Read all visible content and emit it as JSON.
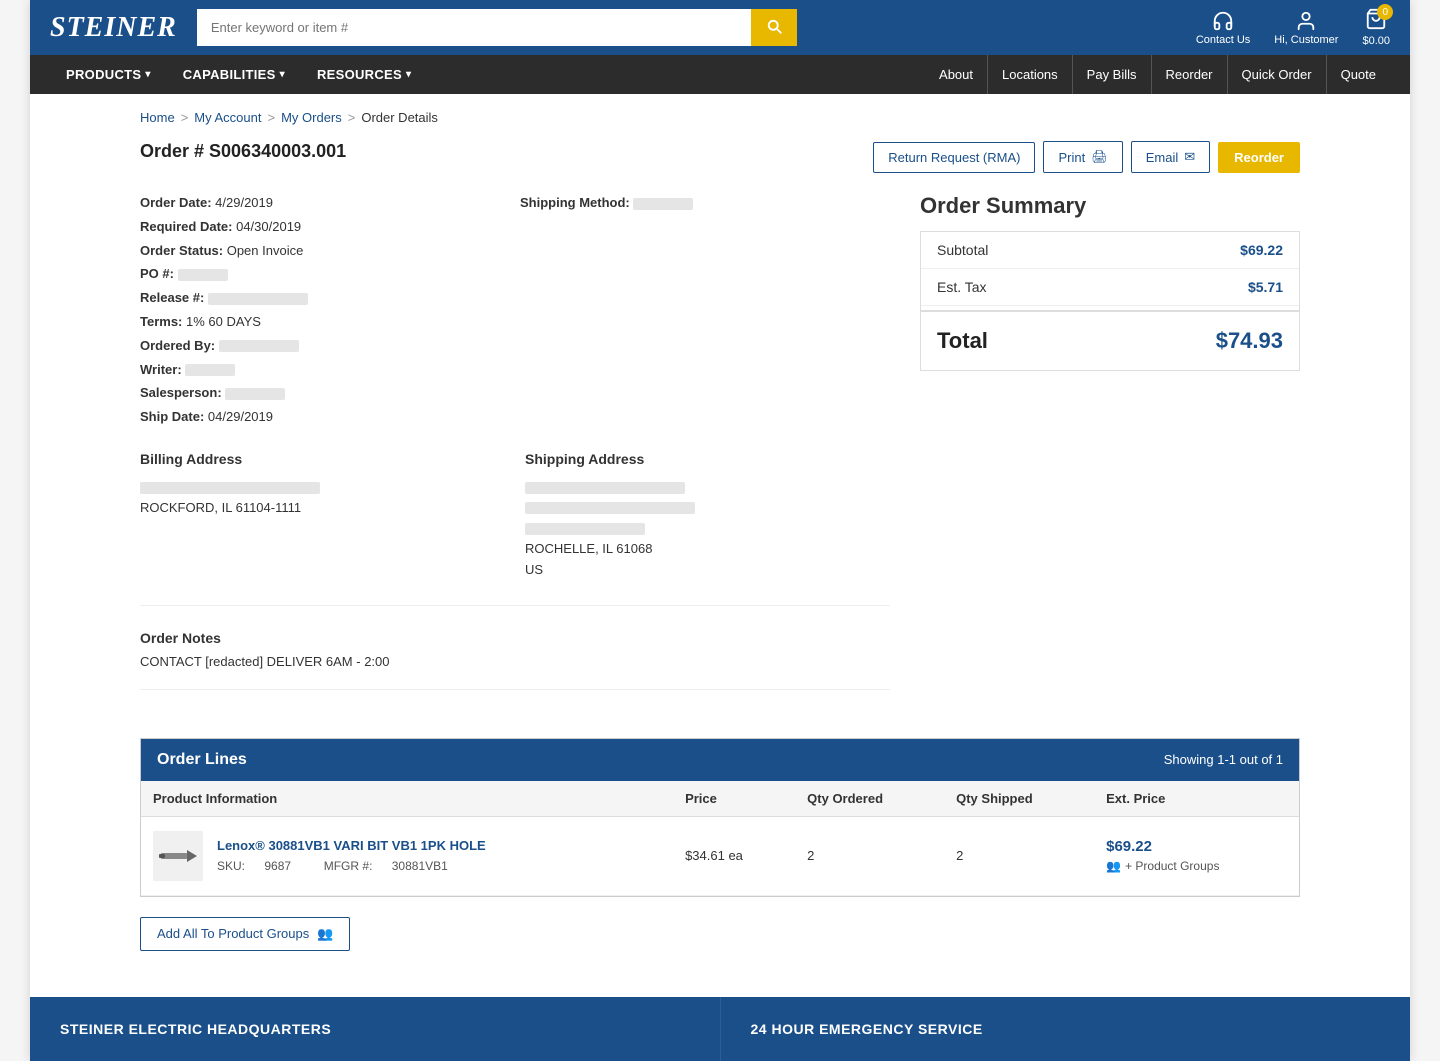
{
  "header": {
    "logo": "SteineR",
    "search_placeholder": "Enter keyword or item #",
    "contact_label": "Contact Us",
    "account_label": "Hi, Customer",
    "cart_label": "$0.00",
    "cart_count": "0"
  },
  "nav": {
    "left_items": [
      {
        "label": "PRODUCTS",
        "has_dropdown": true
      },
      {
        "label": "CAPABILITIES",
        "has_dropdown": true
      },
      {
        "label": "RESOURCES",
        "has_dropdown": true
      }
    ],
    "right_items": [
      {
        "label": "About"
      },
      {
        "label": "Locations"
      },
      {
        "label": "Pay Bills"
      },
      {
        "label": "Reorder"
      },
      {
        "label": "Quick Order"
      },
      {
        "label": "Quote"
      }
    ]
  },
  "breadcrumb": {
    "items": [
      {
        "label": "Home",
        "link": true
      },
      {
        "label": "My Account",
        "link": true
      },
      {
        "label": "My Orders",
        "link": true
      },
      {
        "label": "Order Details",
        "link": false
      }
    ]
  },
  "order": {
    "number": "Order # S006340003.001",
    "date": "4/29/2019",
    "required_date": "04/30/2019",
    "status": "Open Invoice",
    "po_number": "[redacted]",
    "release_number": "[redacted]",
    "terms": "1% 60 DAYS",
    "ordered_by": "[redacted]",
    "writer": "[redacted]",
    "salesperson": "[redacted]",
    "ship_date": "04/29/2019",
    "shipping_method": "[redacted]"
  },
  "actions": {
    "return_request": "Return Request (RMA)",
    "print": "Print",
    "email": "Email",
    "reorder": "Reorder"
  },
  "order_summary": {
    "title": "Order Summary",
    "subtotal_label": "Subtotal",
    "subtotal_value": "$69.22",
    "tax_label": "Est. Tax",
    "tax_value": "$5.71",
    "total_label": "Total",
    "total_value": "$74.93"
  },
  "billing_address": {
    "title": "Billing Address",
    "line1": "[redacted address line 1]",
    "city_state_zip": "ROCKFORD, IL 61104-1111"
  },
  "shipping_address": {
    "title": "Shipping Address",
    "line1": "[redacted address line 1]",
    "line2": "[redacted address line 2]",
    "line3": "[redacted address line 3]",
    "city_state_zip": "ROCHELLE, IL 61068",
    "country": "US"
  },
  "order_notes": {
    "title": "Order Notes",
    "text": "CONTACT [redacted] DELIVER 6AM - 2:00"
  },
  "order_lines": {
    "title": "Order Lines",
    "showing": "Showing 1-1 out of 1",
    "columns": [
      "Product Information",
      "Price",
      "Qty Ordered",
      "Qty Shipped",
      "Ext. Price"
    ],
    "items": [
      {
        "name": "Lenox® 30881VB1 VARI BIT VB1 1PK HOLE",
        "price": "$34.61 ea",
        "qty_ordered": "2",
        "qty_shipped": "2",
        "ext_price": "$69.22",
        "product_groups": "+ Product Groups",
        "sku_label": "SKU:",
        "sku_value": "9687",
        "mfgr_label": "MFGR #:",
        "mfgr_value": "30881VB1"
      }
    ]
  },
  "add_to_groups_label": "Add All To Product Groups",
  "footer": {
    "left": "STEINER ELECTRIC HEADQUARTERS",
    "right": "24 HOUR EMERGENCY SERVICE"
  }
}
